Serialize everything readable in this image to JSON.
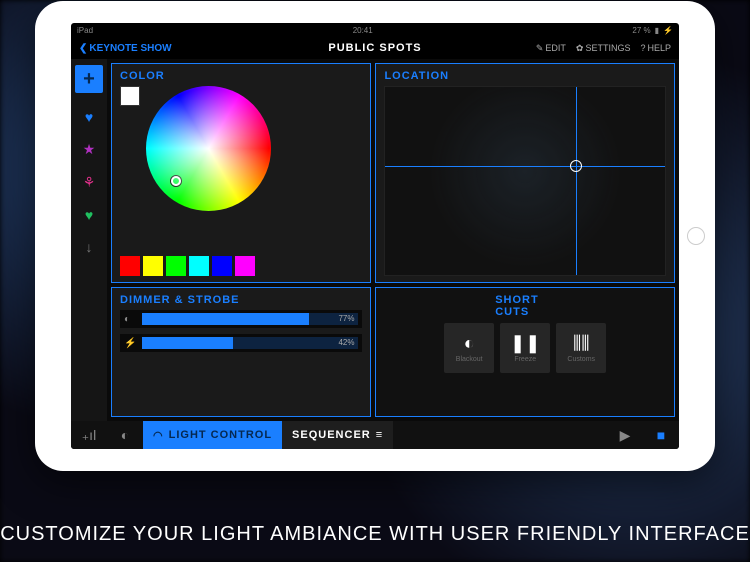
{
  "status": {
    "device": "iPad",
    "wifi": "᯾",
    "time": "20:41",
    "battery": "27 %",
    "charging": "⚡"
  },
  "topbar": {
    "back": "KEYNOTE SHOW",
    "title": "PUBLIC SPOTS",
    "edit": "EDIT",
    "settings": "SETTINGS",
    "help": "HELP"
  },
  "sidebar": {
    "items": [
      {
        "name": "heart-blue",
        "glyph": "♥",
        "color": "#1a7fff"
      },
      {
        "name": "star-purple",
        "glyph": "★",
        "color": "#b030c0"
      },
      {
        "name": "group-pink",
        "glyph": "⚘",
        "color": "#e0308a"
      },
      {
        "name": "heart-green",
        "glyph": "♥",
        "color": "#20c060"
      },
      {
        "name": "arrow-down",
        "glyph": "↓",
        "color": "#777"
      }
    ]
  },
  "color": {
    "label": "COLOR",
    "swatches": [
      "#ff0000",
      "#ffff00",
      "#00ff00",
      "#00ffff",
      "#0000ff",
      "#ff00ff"
    ]
  },
  "dimmer": {
    "label": "DIMMER & STROBE",
    "rows": [
      {
        "icon": "◐",
        "value": 77,
        "text": "77%"
      },
      {
        "icon": "⚡",
        "value": 42,
        "text": "42%"
      }
    ]
  },
  "location": {
    "label": "LOCATION"
  },
  "shortcuts": {
    "label": "SHORT CUTS",
    "buttons": [
      {
        "name": "blackout",
        "icon": "◐",
        "label": "Blackout"
      },
      {
        "name": "freeze",
        "icon": "❚❚",
        "label": "Freeze"
      },
      {
        "name": "customs",
        "icon": "⫼⫼",
        "label": "Customs"
      }
    ]
  },
  "bottombar": {
    "lightcontrol": "LIGHT CONTROL",
    "sequencer": "SEQUENCER"
  },
  "tagline": "CUSTOMIZE YOUR LIGHT AMBIANCE WITH USER FRIENDLY INTERFACE"
}
